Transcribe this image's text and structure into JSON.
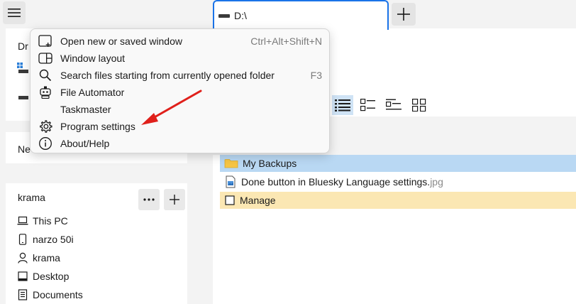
{
  "tab": {
    "title": "D:\\"
  },
  "new_tab": {
    "icon": "plus-icon"
  },
  "sidebar": {
    "drives_peek": "Dr",
    "network_peek": "Ne",
    "user_section": {
      "title": "krama",
      "items": [
        {
          "label": "This PC",
          "icon": "laptop-icon"
        },
        {
          "label": "narzo 50i",
          "icon": "phone-icon"
        },
        {
          "label": "krama",
          "icon": "user-icon"
        },
        {
          "label": "Desktop",
          "icon": "desktop-icon"
        },
        {
          "label": "Documents",
          "icon": "documents-icon"
        }
      ]
    }
  },
  "menu": {
    "items": [
      {
        "label": "Open new or saved window",
        "shortcut": "Ctrl+Alt+Shift+N",
        "icon": "new-window-icon"
      },
      {
        "label": "Window layout",
        "shortcut": "",
        "icon": "window-layout-icon"
      },
      {
        "label": "Search files starting from currently opened folder",
        "shortcut": "F3",
        "icon": "search-icon"
      },
      {
        "label": "File Automator",
        "shortcut": "",
        "icon": "robot-icon"
      },
      {
        "label": "Taskmaster",
        "shortcut": "",
        "icon": ""
      },
      {
        "label": "Program settings",
        "shortcut": "",
        "icon": "gear-icon"
      },
      {
        "label": "About/Help",
        "shortcut": "",
        "icon": "info-icon"
      }
    ]
  },
  "files": [
    {
      "name": "My Backups",
      "ext": "",
      "type": "folder",
      "state": "selected"
    },
    {
      "name": "Done button in Bluesky Language settings.",
      "ext": "jpg",
      "type": "image",
      "state": "normal"
    },
    {
      "name": "Manage",
      "ext": "",
      "type": "checkbox-item",
      "state": "highlighted"
    }
  ],
  "colors": {
    "accent": "#1a73e8",
    "selection": "#b9d8f3",
    "highlight": "#fbe7b3",
    "annotation_arrow": "#e0201b"
  }
}
